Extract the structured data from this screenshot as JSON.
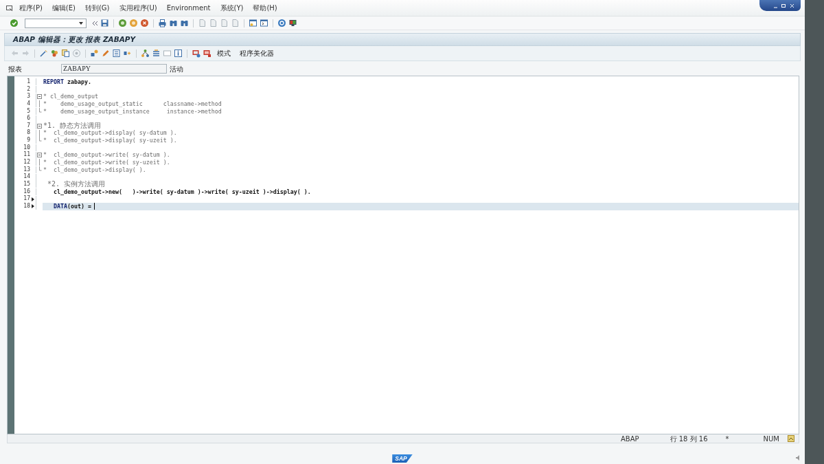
{
  "menu": [
    "程序(P)",
    "编辑(E)",
    "转到(G)",
    "实用程序(U)",
    "Environment",
    "系统(Y)",
    "帮助(H)"
  ],
  "title": "ABAP 编辑器：更改 报表 ZABAPY",
  "app_toolbar": {
    "buttons": [
      "模式",
      "程序美化器"
    ]
  },
  "report_field": {
    "label": "报表",
    "value": "ZABAPY",
    "status": "活动"
  },
  "editor": {
    "lines": [
      {
        "number": "1",
        "marked": false,
        "current": false,
        "segments": [
          {
            "kind": "keyword",
            "text": "REPORT"
          },
          {
            "kind": "code",
            "text": " zabapy."
          }
        ]
      },
      {
        "number": "2",
        "marked": false,
        "current": false
      },
      {
        "number": "3",
        "expanded": true,
        "marked": false,
        "current": false,
        "segments": [
          {
            "kind": "comment",
            "text": "* cl_demo_output"
          }
        ],
        "children": [
          {
            "number": "4",
            "marked": false,
            "current": false,
            "segments": [
              {
                "kind": "comment",
                "text": "*    demo_usage_output_static      classname->method"
              }
            ]
          },
          {
            "number": "5",
            "marked": false,
            "current": false,
            "segments": [
              {
                "kind": "comment",
                "text": "*    demo_usage_output_instance     instance->method"
              }
            ]
          }
        ]
      },
      {
        "number": "6",
        "marked": false,
        "current": false
      },
      {
        "number": "7",
        "expanded": true,
        "marked": false,
        "current": false,
        "segments": [
          {
            "kind": "heading",
            "text": "*1. 静态方法调用"
          }
        ],
        "children": [
          {
            "number": "8",
            "marked": false,
            "current": false,
            "segments": [
              {
                "kind": "comment",
                "text": "*  cl_demo_output->display( sy-datum )."
              }
            ]
          },
          {
            "number": "9",
            "marked": false,
            "current": false,
            "segments": [
              {
                "kind": "comment",
                "text": "*  cl_demo_output->display( sy-uzeit )."
              }
            ]
          }
        ]
      },
      {
        "number": "10",
        "marked": false,
        "current": false
      },
      {
        "number": "11",
        "expanded": true,
        "marked": false,
        "current": false,
        "segments": [
          {
            "kind": "comment",
            "text": "*  cl_demo_output->write( sy-datum )."
          }
        ],
        "children": [
          {
            "number": "12",
            "marked": false,
            "current": false,
            "segments": [
              {
                "kind": "comment",
                "text": "*  cl_demo_output->write( sy-uzeit )."
              }
            ]
          },
          {
            "number": "13",
            "marked": false,
            "current": false,
            "segments": [
              {
                "kind": "comment",
                "text": "*  cl_demo_output->display( )."
              }
            ]
          }
        ]
      },
      {
        "number": "14",
        "marked": false,
        "current": false
      },
      {
        "number": "15",
        "marked": false,
        "current": false,
        "segments": [
          {
            "kind": "heading",
            "text": " *2. 实例方法调用"
          }
        ]
      },
      {
        "number": "16",
        "marked": false,
        "current": false,
        "segments": [
          {
            "kind": "code",
            "text": "   cl_demo_output->new(   )->write( sy-datum )->write( sy-uzeit )->display( )."
          }
        ]
      },
      {
        "number": "17",
        "marked": true,
        "current": false
      },
      {
        "number": "18",
        "marked": true,
        "current": true,
        "segments": [
          {
            "kind": "keyword",
            "text": "   DATA"
          },
          {
            "kind": "code",
            "text": "(out) ="
          }
        ]
      }
    ]
  },
  "status_bar": {
    "items": [
      "ABAP",
      "行 18 列 16",
      "*",
      "NUM"
    ]
  },
  "footer": {
    "logo": "SAP"
  }
}
